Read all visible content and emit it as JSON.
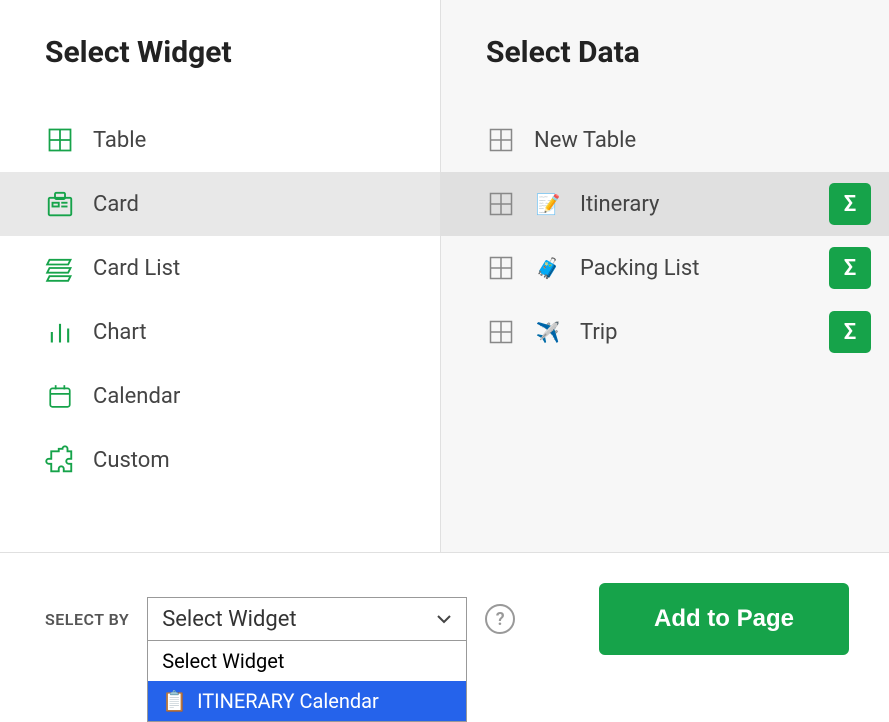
{
  "colors": {
    "accent_green": "#16a34a",
    "selection_bg": "#e8e8e8",
    "highlight_blue": "#2563eb"
  },
  "left": {
    "title": "Select Widget",
    "items": [
      {
        "label": "Table",
        "icon": "table-icon",
        "selected": false
      },
      {
        "label": "Card",
        "icon": "card-icon",
        "selected": true
      },
      {
        "label": "Card List",
        "icon": "cardlist-icon",
        "selected": false
      },
      {
        "label": "Chart",
        "icon": "chart-icon",
        "selected": false
      },
      {
        "label": "Calendar",
        "icon": "calendar-icon",
        "selected": false
      },
      {
        "label": "Custom",
        "icon": "puzzle-icon",
        "selected": false
      }
    ]
  },
  "right": {
    "title": "Select Data",
    "items": [
      {
        "label": "New Table",
        "icon": "table-icon",
        "emoji": "",
        "selected": false,
        "has_summary": false
      },
      {
        "label": "Itinerary",
        "icon": "table-icon",
        "emoji": "📝",
        "selected": true,
        "has_summary": true
      },
      {
        "label": "Packing List",
        "icon": "table-icon",
        "emoji": "🧳",
        "selected": false,
        "has_summary": true
      },
      {
        "label": "Trip",
        "icon": "table-icon",
        "emoji": "✈️",
        "selected": false,
        "has_summary": true
      }
    ]
  },
  "footer": {
    "select_by_label": "SELECT BY",
    "select_value": "Select Widget",
    "help_symbol": "?",
    "add_button_label": "Add to Page",
    "dropdown": {
      "options": [
        {
          "label": "Select Widget",
          "highlighted": false,
          "emoji": ""
        },
        {
          "label": "ITINERARY Calendar",
          "highlighted": true,
          "emoji": "📋"
        }
      ]
    }
  }
}
